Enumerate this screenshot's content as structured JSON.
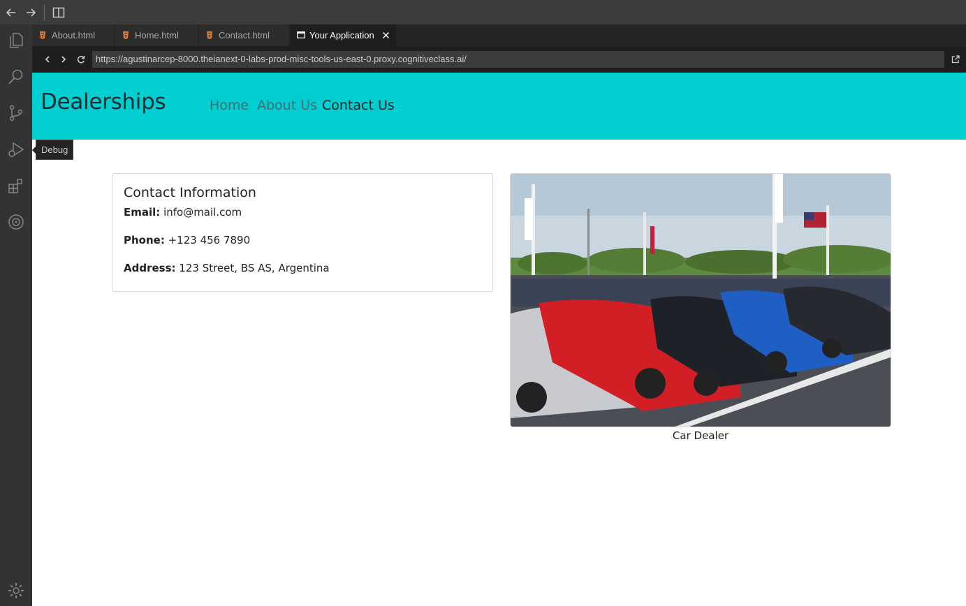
{
  "ide": {
    "tabs": [
      {
        "label": "About.html",
        "icon": "html-file-icon"
      },
      {
        "label": "Home.html",
        "icon": "html-file-icon"
      },
      {
        "label": "Contact.html",
        "icon": "html-file-icon"
      },
      {
        "label": "Your Application",
        "icon": "browser-window-icon",
        "active": true
      }
    ],
    "tooltip": "Debug",
    "url": "https://agustinarcep-8000.theianext-0-labs-prod-misc-tools-us-east-0.proxy.cognitiveclass.ai/",
    "activity_icons": [
      "explorer-icon",
      "search-icon",
      "source-control-icon",
      "run-debug-icon",
      "extensions-icon",
      "skills-network-icon",
      "settings-gear-icon"
    ],
    "colors": {
      "navbar": "#00ced1",
      "activity_bar": "#333333",
      "titlebar": "#3c3c3c"
    }
  },
  "app": {
    "brand": "Dealerships",
    "nav": {
      "home": "Home",
      "about": "About Us",
      "contact": "Contact Us"
    },
    "contact": {
      "title": "Contact Information",
      "email_label": "Email:",
      "email_value": "info@mail.com",
      "phone_label": "Phone:",
      "phone_value": "+123 456 7890",
      "address_label": "Address:",
      "address_value": "123 Street, BS AS, Argentina"
    },
    "image_caption": "Car Dealer"
  }
}
